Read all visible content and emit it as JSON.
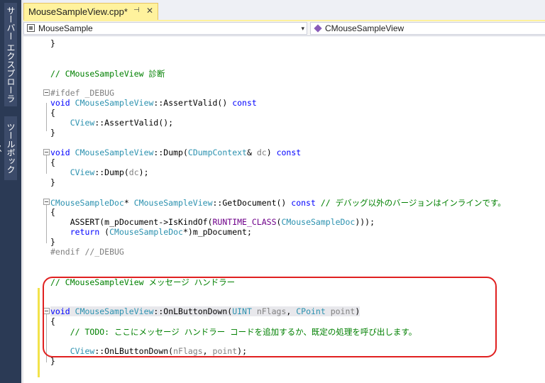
{
  "sidebar": {
    "tabs": [
      {
        "label": "サーバー エクスプローラー"
      },
      {
        "label": "ツールボックス"
      }
    ]
  },
  "tab": {
    "title": "MouseSampleView.cpp*",
    "pin_glyph": "⊣",
    "close_glyph": "✕"
  },
  "nav": {
    "left_combo": "MouseSample",
    "right_combo": "CMouseSampleView",
    "arrow": "▾"
  },
  "code": {
    "line_top_fragment": "}",
    "comment_diag": "// CMouseSampleView 診断",
    "ifdef": "#ifdef _DEBUG",
    "assertvalid_sig": {
      "kw1": "void",
      "cls": "CMouseSampleView",
      "rest": "::AssertValid() ",
      "kw2": "const"
    },
    "brace_open": "{",
    "brace_close": "}",
    "cview_assertvalid": {
      "cls": "CView",
      "rest": "::AssertValid();"
    },
    "dump_sig": {
      "kw1": "void",
      "cls": "CMouseSampleView",
      "mid": "::Dump(",
      "ty": "CDumpContext",
      "amp": "& ",
      "par": "dc",
      "close": ") ",
      "kw2": "const"
    },
    "cview_dump": {
      "cls": "CView",
      "mid": "::Dump(",
      "par": "dc",
      "close": ");"
    },
    "getdoc_sig": {
      "ty": "CMouseSampleDoc",
      "star": "* ",
      "cls": "CMouseSampleView",
      "mid": "::GetDocument() ",
      "kw": "const",
      "cmt": " // デバッグ以外のバージョンはインラインです。"
    },
    "assert_line": {
      "a": "ASSERT(m_pDocument->IsKindOf(",
      "mac": "RUNTIME_CLASS",
      "b": "(",
      "ty": "CMouseSampleDoc",
      "c": ")));"
    },
    "return_line": {
      "kw": "return",
      "a": " (",
      "ty": "CMouseSampleDoc",
      "b": "*)m_pDocument;"
    },
    "endif": "#endif //_DEBUG",
    "comment_handler": "// CMouseSampleView メッセージ ハンドラー",
    "onlbutton_sig": {
      "kw": "void",
      "cls": "CMouseSampleView",
      "mid": "::OnLButtonDown(",
      "ty1": "UINT",
      "p1": " nFlags",
      "comma": ", ",
      "ty2": "CPoint",
      "p2": " point",
      "close": ")"
    },
    "todo_comment": "// TODO: ここにメッセージ ハンドラー コードを追加するか、既定の処理を呼び出します。",
    "cview_onlbutton": {
      "cls": "CView",
      "mid": "::OnLButtonDown(",
      "p1": "nFlags",
      "comma": ", ",
      "p2": "point",
      "close": ");"
    }
  },
  "colors": {
    "keyword": "#0000ff",
    "type": "#2b91af",
    "comment": "#008000",
    "annotation": "#e02020",
    "active_tab": "#fff29d"
  }
}
